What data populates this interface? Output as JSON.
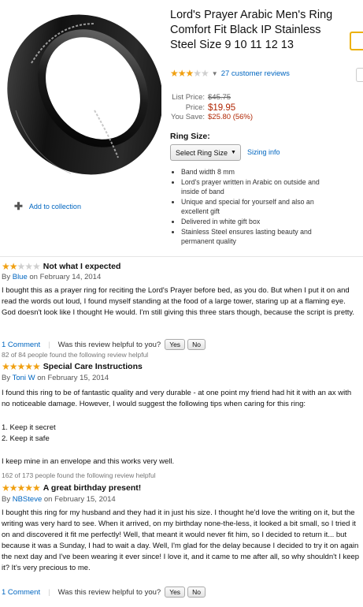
{
  "product": {
    "title": "Lord's Prayer Arabic Men's Ring Comfort Fit Black IP Stainless Steel Size 9 10 11 12 13",
    "rating_stars": 3,
    "review_count_text": "27 customer reviews",
    "list_price_label": "List Price:",
    "list_price": "$45.75",
    "price_label": "Price:",
    "price": "$19.95",
    "save_label": "You Save:",
    "save_value": "$25.80 (56%)",
    "size_label": "Ring Size:",
    "size_select": "Select Ring Size",
    "sizing_info": "Sizing info",
    "bullets": [
      "Band width 8 mm",
      "Lord's prayer written in Arabic on outside and inside of band",
      "Unique and special for yourself and also an excellent gift",
      "Delivered in white gift box",
      "Stainless Steel ensures lasting beauty and permanent quality"
    ],
    "add_to_collection": "Add to collection",
    "colors": {
      "star": "#f0a012",
      "link": "#0066c0",
      "price": "#b12704"
    }
  },
  "reviews": [
    {
      "stars": 2,
      "title": "Not what I expected",
      "by": "By",
      "author": "Blue",
      "date": "on February 14, 2014",
      "body": "I bought this as a prayer ring for reciting the Lord's Prayer before bed, as you do. But when I put it on and read the words out loud, I found myself standing at the food of a large tower, staring up at a flaming eye. God doesn't look like I thought He would. I'm still giving this three stars though, because the script is pretty.",
      "comment": "1 Comment",
      "helpful_q": "Was this review helpful to you?",
      "yes": "Yes",
      "no": "No"
    },
    {
      "found": "82 of 84 people found the following review helpful",
      "stars": 5,
      "title": "Special Care Instructions",
      "by": "By",
      "author": "Toni W",
      "date": "on February 15, 2014",
      "body1": "I found this ring to be of fantastic quality and very durable - at one point my friend had hit it with an ax with no noticeable damage. However, I would suggest the following tips when caring for this ring:",
      "tip1": "1. Keep it secret",
      "tip2": "2. Keep it safe",
      "body2": "I keep mine in an envelope and this works very well."
    },
    {
      "found": "162 of 173 people found the following review helpful",
      "stars": 5,
      "title": "A great birthday present!",
      "by": "By",
      "author": "NBSteve",
      "date": "on February 15, 2014",
      "body": "I bought this ring for my husband and they had it in just his size. I thought he'd love the writing on it, but the writing was very hard to see. When it arrived, on my birthday none-the-less, it looked a bit small, so I tried it on and discovered it fit me perfectly! Well, that meant it would never fit him, so I decided to return it... but because it was a Sunday, I had to wait a day. Well, I'm glad for the delay because I decided to try it on again the next day and I've been wearing it ever since! I love it, and it came to me after all, so why shouldn't I keep it? It's very precious to me.",
      "comment": "1 Comment",
      "helpful_q": "Was this review helpful to you?",
      "yes": "Yes",
      "no": "No"
    }
  ]
}
